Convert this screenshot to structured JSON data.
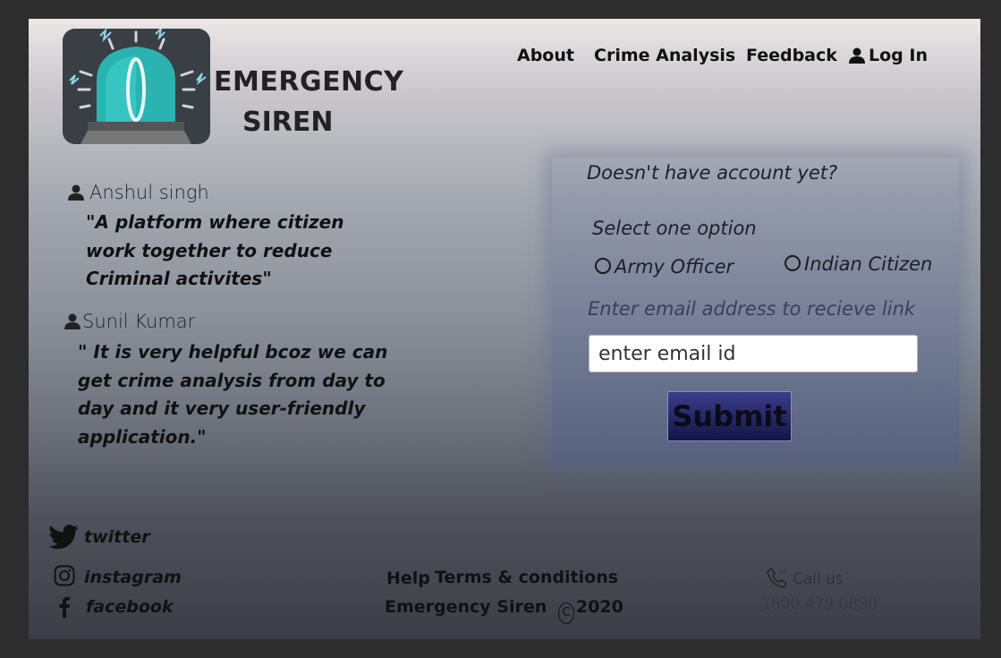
{
  "brand": {
    "line1": "EMERGENCY",
    "line2": "SIREN",
    "logo_icon": "siren-icon"
  },
  "nav": {
    "about": "About",
    "crime_analysis": "Crime Analysis",
    "feedback": "Feedback",
    "login": "Log In"
  },
  "testimonials": [
    {
      "name": "Anshul singh",
      "quote_lines": [
        "\"A platform where citizen",
        "work together to reduce",
        "Criminal activites\""
      ]
    },
    {
      "name": "Sunil Kumar",
      "quote_lines": [
        "\" It is very helpful bcoz we can",
        "get crime analysis from day to",
        "day and it very user-friendly",
        "application.\""
      ]
    }
  ],
  "signup": {
    "heading": "Doesn't have account yet?",
    "select_label": "Select one option",
    "options": [
      "Army Officer",
      "Indian Citizen"
    ],
    "email_label": "Enter email address to recieve link",
    "email_placeholder": "enter email id",
    "submit_label": "Submit"
  },
  "footer": {
    "social": [
      "twitter",
      "instagram",
      "facebook"
    ],
    "help": "Help",
    "terms": "Terms & conditions",
    "copyright_name": "Emergency Siren",
    "copyright_year": "2020",
    "call_label": "Call us",
    "phone": "1800 479 0890"
  },
  "colors": {
    "outer_bg": "#2d2d2d",
    "submit_bg": "#1d1f5e",
    "logo_teal": "#2ab3b1"
  }
}
